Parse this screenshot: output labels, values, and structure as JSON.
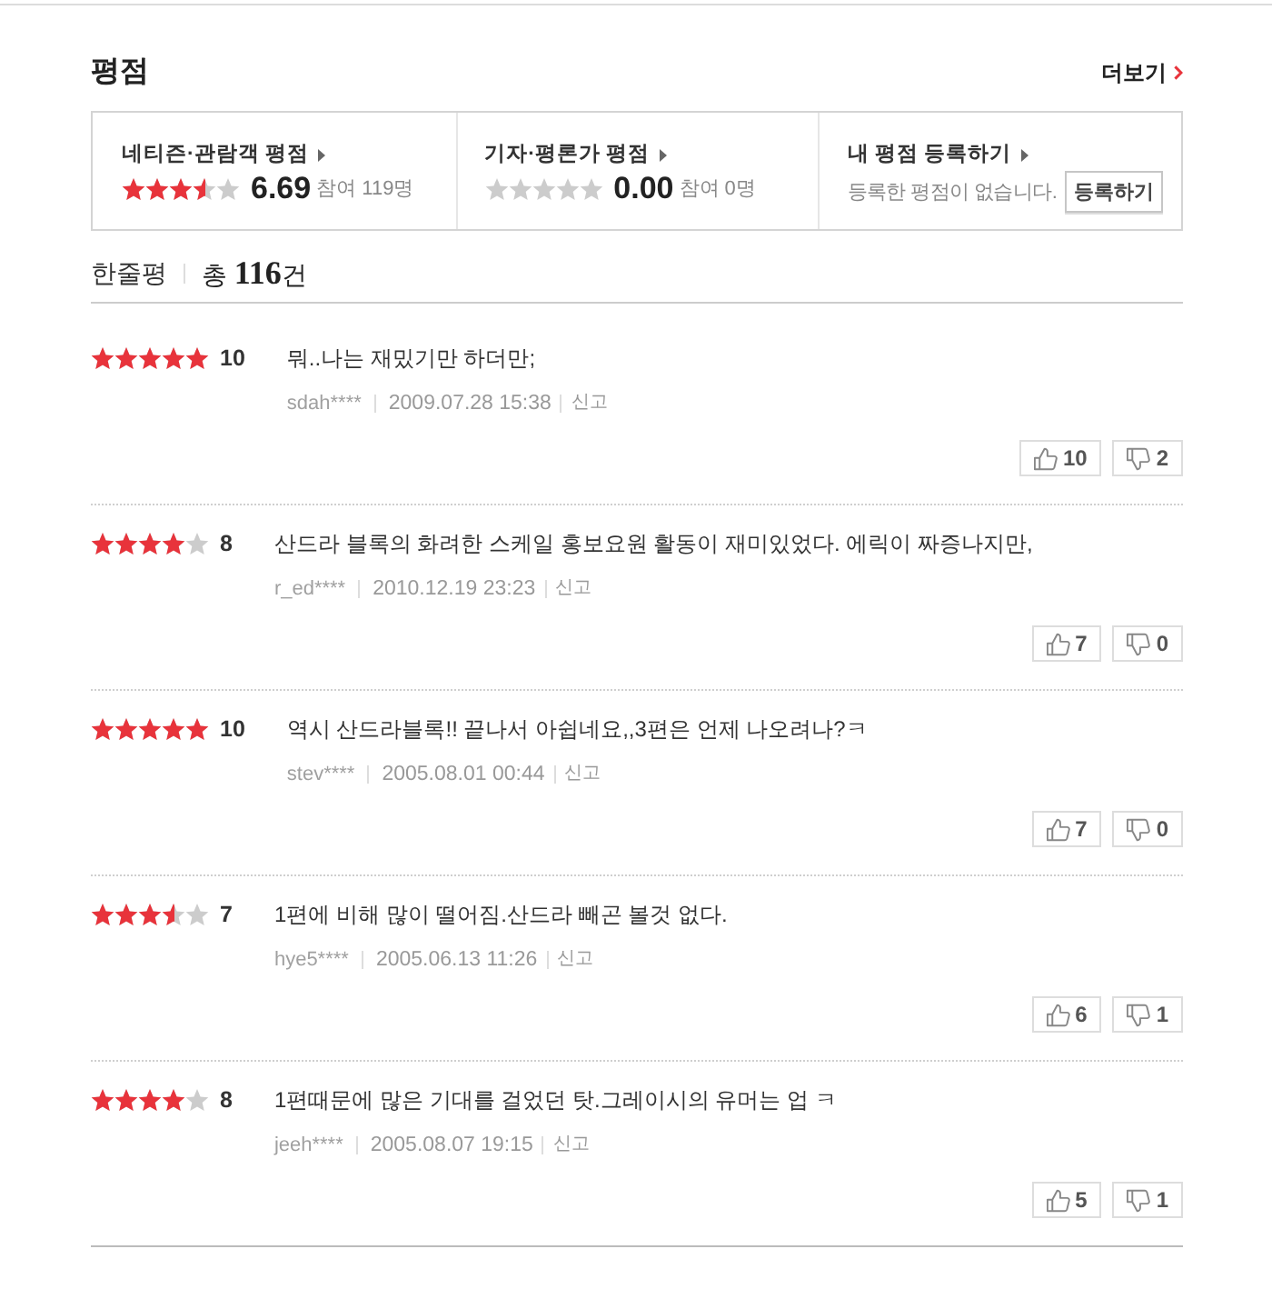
{
  "section": {
    "title": "평점",
    "more_link": "더보기"
  },
  "summary": [
    {
      "kind": "rating",
      "label": "네티즌·관람객 평점",
      "stars": 3.5,
      "score": "6.69",
      "participants": "참여 119명"
    },
    {
      "kind": "rating",
      "label": "기자·평론가 평점",
      "stars": 0,
      "score": "0.00",
      "participants": "참여 0명"
    },
    {
      "kind": "register",
      "label": "내 평점 등록하기",
      "message": "등록한 평점이 없습니다.",
      "button": "등록하기"
    }
  ],
  "review_header": {
    "title": "한줄평",
    "count": "총 **116**건"
  },
  "reviews": [
    {
      "stars": 5,
      "score": "10",
      "comment": "뭐..나는 재밌기만 하더만;",
      "user": "sdah****",
      "date": "2009.07.28 15:38",
      "report": "신고",
      "likes": "10",
      "dislikes": "2"
    },
    {
      "stars": 4,
      "score": "8",
      "comment": "산드라 블록의 화려한 스케일 홍보요원 활동이 재미있었다. 에릭이 짜증나지만,",
      "user": "r_ed****",
      "date": "2010.12.19 23:23",
      "report": "신고",
      "likes": "7",
      "dislikes": "0"
    },
    {
      "stars": 5,
      "score": "10",
      "comment": "역시 산드라블록!! 끝나서 아쉽네요,,3편은 언제 나오려나?ㅋ",
      "user": "stev****",
      "date": "2005.08.01 00:44",
      "report": "신고",
      "likes": "7",
      "dislikes": "0"
    },
    {
      "stars": 3.5,
      "score": "7",
      "comment": "1편에 비해 많이 떨어짐.산드라 빼곤 볼것 없다.",
      "user": "hye5****",
      "date": "2005.06.13 11:26",
      "report": "신고",
      "likes": "6",
      "dislikes": "1"
    },
    {
      "stars": 4,
      "score": "8",
      "comment": "1편때문에 많은 기대를 걸었던 탓.그레이시의 유머는 업 ㅋ",
      "user": "jeeh****",
      "date": "2005.08.07 19:15",
      "report": "신고",
      "likes": "5",
      "dislikes": "1"
    }
  ]
}
